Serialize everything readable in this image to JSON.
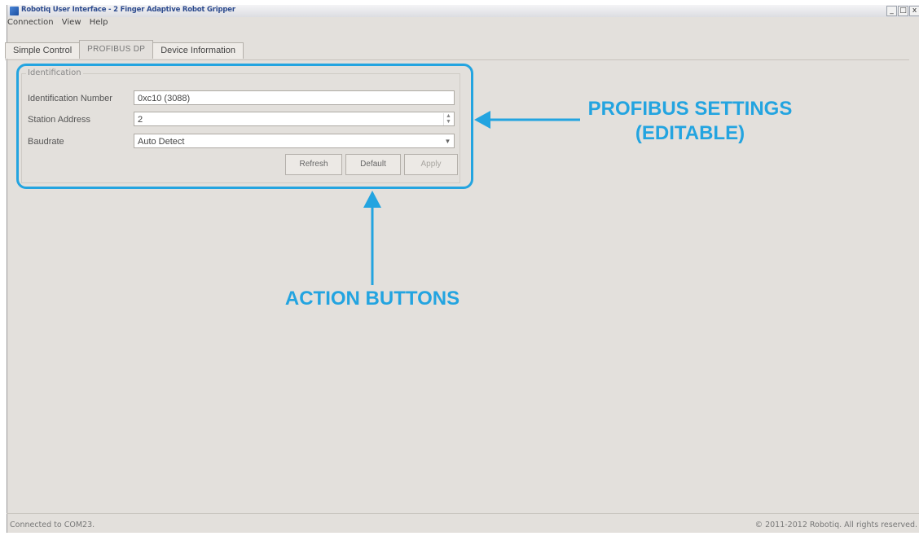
{
  "window": {
    "title": "Robotiq User Interface - 2 Finger Adaptive Robot Gripper",
    "controls": [
      "_",
      "□",
      "x"
    ]
  },
  "menu": [
    "Connection",
    "View",
    "Help"
  ],
  "tabs": [
    "Simple Control",
    "PROFIBUS DP",
    "Device Information"
  ],
  "group": {
    "label": "Identification",
    "fields": [
      {
        "label": "Identification Number",
        "value": "0xc10 (3088)"
      },
      {
        "label": "Station Address",
        "value": "2"
      },
      {
        "label": "Baudrate",
        "value": "Auto Detect"
      }
    ],
    "buttons": {
      "refresh": "Refresh",
      "default": "Default",
      "apply": "Apply"
    }
  },
  "annotations": {
    "settings_line1": "PROFIBUS SETTINGS",
    "settings_line2": "(EDITABLE)",
    "actions": "ACTION BUTTONS",
    "color": "#23a4e0"
  },
  "status": {
    "left": "Connected to COM23.",
    "right": "© 2011-2012 Robotiq. All rights reserved."
  }
}
